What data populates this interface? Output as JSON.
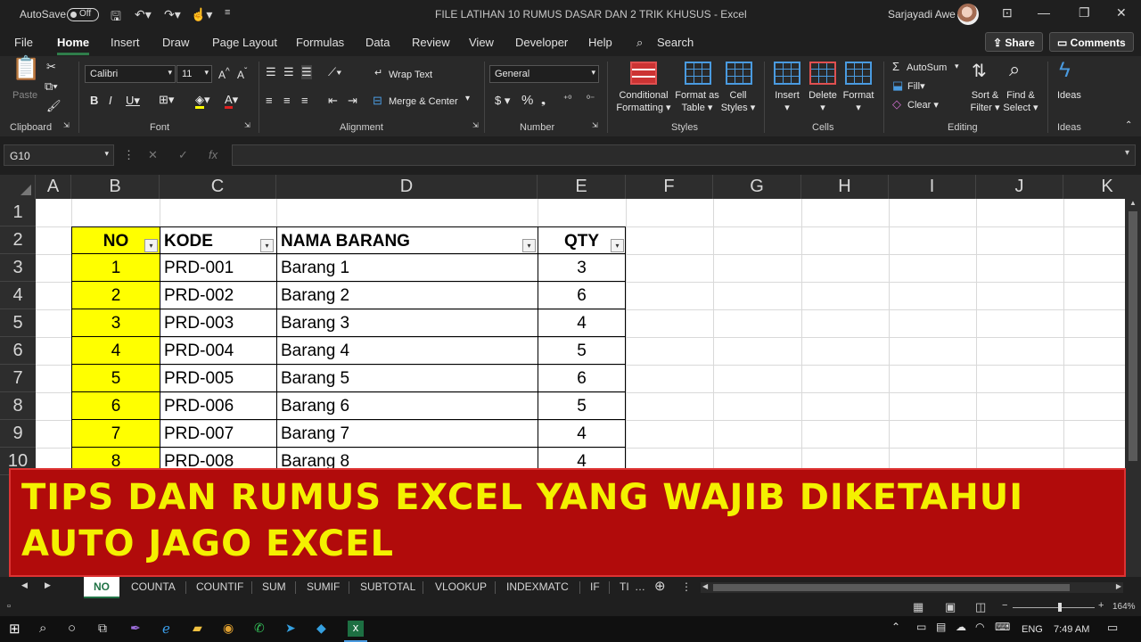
{
  "titlebar": {
    "autosave_label": "AutoSave",
    "autosave_state": "Off",
    "title": "FILE LATIHAN 10 RUMUS DASAR DAN 2 TRIK KHUSUS  -  Excel",
    "user": "Sarjayadi Awe"
  },
  "menu": {
    "tabs": [
      "File",
      "Home",
      "Insert",
      "Draw",
      "Page Layout",
      "Formulas",
      "Data",
      "Review",
      "View",
      "Developer",
      "Help"
    ],
    "search": "Search",
    "share": "Share",
    "comments": "Comments"
  },
  "ribbon": {
    "clipboard": {
      "label": "Clipboard",
      "paste": "Paste"
    },
    "font": {
      "label": "Font",
      "name": "Calibri",
      "size": "11"
    },
    "alignment": {
      "label": "Alignment",
      "wrap": "Wrap Text",
      "merge": "Merge & Center"
    },
    "number": {
      "label": "Number",
      "format": "General"
    },
    "styles": {
      "label": "Styles",
      "cond1": "Conditional",
      "cond2": "Formatting",
      "fmt1": "Format as",
      "fmt2": "Table",
      "cell1": "Cell",
      "cell2": "Styles"
    },
    "cells": {
      "label": "Cells",
      "insert": "Insert",
      "delete": "Delete",
      "format": "Format"
    },
    "editing": {
      "label": "Editing",
      "autosum": "AutoSum",
      "fill": "Fill",
      "clear": "Clear",
      "sort1": "Sort &",
      "sort2": "Filter",
      "find1": "Find &",
      "find2": "Select"
    },
    "ideas": {
      "label": "Ideas",
      "btn": "Ideas"
    }
  },
  "formula_bar": {
    "name_box": "G10",
    "fx": "fx",
    "value": ""
  },
  "grid": {
    "columns": [
      "A",
      "B",
      "C",
      "D",
      "E",
      "F",
      "G",
      "H",
      "I",
      "J",
      "K"
    ],
    "rows": [
      "1",
      "2",
      "3",
      "4",
      "5",
      "6",
      "7",
      "8",
      "9",
      "10"
    ],
    "headers": {
      "no": "NO",
      "kode": "KODE",
      "nama": "NAMA BARANG",
      "qty": "QTY"
    },
    "data": [
      {
        "no": "1",
        "kode": "PRD-001",
        "nama": "Barang 1",
        "qty": "3"
      },
      {
        "no": "2",
        "kode": "PRD-002",
        "nama": "Barang 2",
        "qty": "6"
      },
      {
        "no": "3",
        "kode": "PRD-003",
        "nama": "Barang 3",
        "qty": "4"
      },
      {
        "no": "4",
        "kode": "PRD-004",
        "nama": "Barang 4",
        "qty": "5"
      },
      {
        "no": "5",
        "kode": "PRD-005",
        "nama": "Barang 5",
        "qty": "6"
      },
      {
        "no": "6",
        "kode": "PRD-006",
        "nama": "Barang 6",
        "qty": "5"
      },
      {
        "no": "7",
        "kode": "PRD-007",
        "nama": "Barang 7",
        "qty": "4"
      },
      {
        "no": "8",
        "kode": "PRD-008",
        "nama": "Barang 8",
        "qty": "4"
      }
    ]
  },
  "banner": {
    "line1": "TIPS DAN RUMUS EXCEL YANG WAJIB DIKETAHUI",
    "line2": "AUTO JAGO EXCEL"
  },
  "sheet_tabs": [
    "NO",
    "COUNTA",
    "COUNTIF",
    "SUM",
    "SUMIF",
    "SUBTOTAL",
    "VLOOKUP",
    "INDEXMATC",
    "IF",
    "TI"
  ],
  "status": {
    "zoom": "164%"
  },
  "taskbar": {
    "lang": "ENG",
    "time": "7:49 AM"
  },
  "colors": {
    "accent": "#217346",
    "highlight": "#ffff00",
    "banner_bg": "#b10b0b",
    "banner_text": "#f4f100"
  }
}
